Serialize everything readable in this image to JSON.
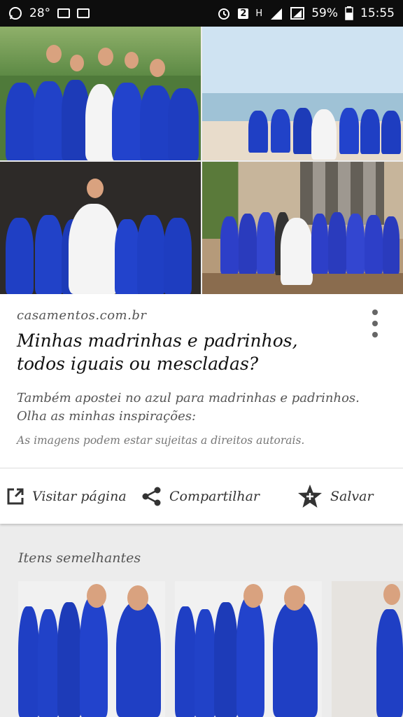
{
  "status_bar": {
    "notification_count": "28°",
    "sim_badge": "2",
    "network_label": "H",
    "battery": "59%",
    "time": "15:55"
  },
  "result": {
    "source": "casamentos.com.br",
    "title": "Minhas madrinhas e padrinhos, todos iguais ou mescladas?",
    "description": "Também apostei no azul para madrinhas e padrinhos. Olha as minhas inspirações:",
    "rights_notice": "As imagens podem estar sujeitas a direitos autorais."
  },
  "actions": {
    "visit_label": "Visitar página",
    "share_label": "Compartilhar",
    "save_label": "Salvar"
  },
  "similar": {
    "heading": "Itens semelhantes"
  },
  "colors": {
    "dress_blue": "#1f3fc4",
    "status_bar": "#0d0d0d"
  }
}
